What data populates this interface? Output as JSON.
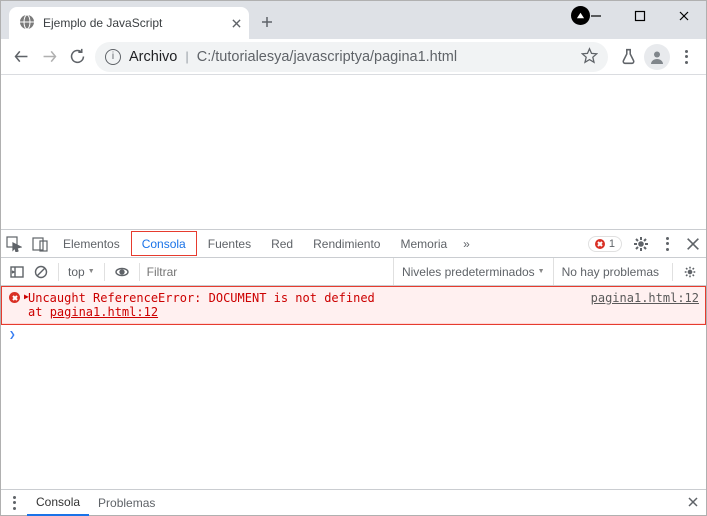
{
  "browser": {
    "tab": {
      "title": "Ejemplo de JavaScript"
    },
    "omni": {
      "prefix": "Archivo",
      "url": "C:/tutorialesya/javascriptya/pagina1.html"
    }
  },
  "devtools": {
    "tabs": {
      "elementos": "Elementos",
      "consola": "Consola",
      "fuentes": "Fuentes",
      "red": "Red",
      "rendimiento": "Rendimiento",
      "memoria": "Memoria"
    },
    "errCount": "1",
    "filter": {
      "context": "top",
      "placeholder": "Filtrar",
      "levels": "Niveles predeterminados",
      "noprob": "No hay problemas"
    },
    "console": {
      "msg": "Uncaught ReferenceError: DOCUMENT is not defined",
      "at_prefix": "    at ",
      "at_loc": "pagina1.html:12",
      "src": "pagina1.html:12"
    },
    "drawer": {
      "consola": "Consola",
      "problemas": "Problemas"
    }
  }
}
